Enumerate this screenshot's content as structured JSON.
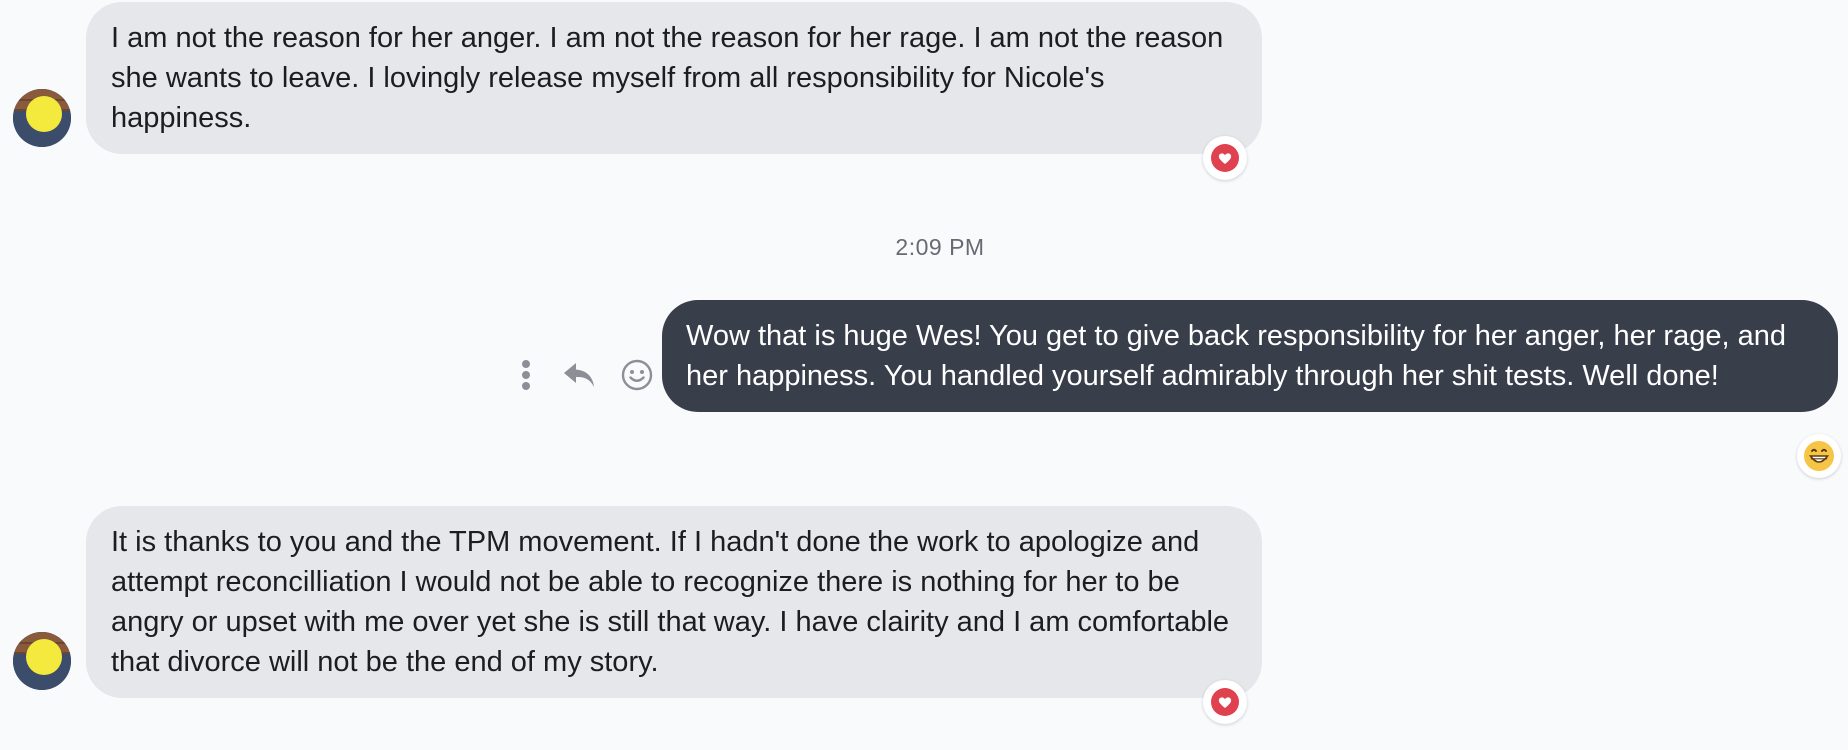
{
  "colors": {
    "incoming_bubble": "#e6e7eb",
    "outgoing_bubble": "#393e4b",
    "heart_reaction": "#e0414f",
    "background": "#f9fafc"
  },
  "messages": [
    {
      "direction": "incoming",
      "text": "I am not the reason for her anger. I am not the reason for her rage. I am not the reason she wants to leave. I lovingly release myself from all responsibility for Nicole's happiness.",
      "reaction": "heart-icon"
    },
    {
      "direction": "outgoing",
      "text": "Wow that is huge Wes! You get to give back responsibility for her anger, her rage, and her happiness. You handled yourself admirably through her shit tests. Well done!",
      "reaction": "grinning-face-icon"
    },
    {
      "direction": "incoming",
      "text": "It is thanks to you and the TPM movement. If I hadn't done the work to apologize and attempt reconcilliation I would not be able to recognize there is nothing for her to be angry or upset with me over yet she is still that way. I have clairity and I am comfortable that divorce will not be the end of my story.",
      "reaction": "heart-icon"
    }
  ],
  "timestamp": "2:09 PM",
  "message_actions": [
    "more-options-icon",
    "reply-icon",
    "add-reaction-icon"
  ]
}
